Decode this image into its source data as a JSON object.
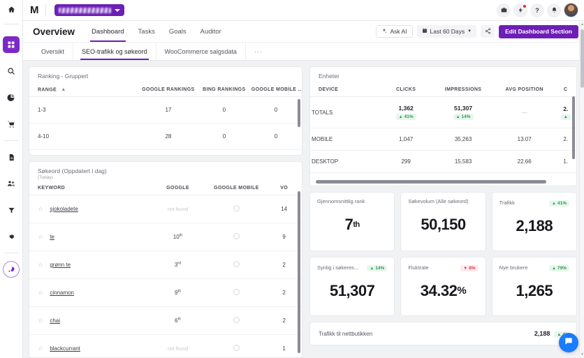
{
  "rail": {
    "home_icon": "home-icon",
    "items": [
      {
        "name": "dashboard",
        "icon": "grid-icon",
        "active": true
      },
      {
        "name": "search",
        "icon": "search-icon",
        "active": false
      },
      {
        "name": "analytics",
        "icon": "pie-chart-icon",
        "active": false
      },
      {
        "name": "ecommerce",
        "icon": "cart-icon",
        "active": false
      },
      {
        "name": "reports",
        "icon": "document-icon",
        "active": false
      },
      {
        "name": "audience",
        "icon": "people-icon",
        "active": false
      },
      {
        "name": "funnel",
        "icon": "funnel-icon",
        "active": false
      },
      {
        "name": "settings",
        "icon": "gear-icon",
        "active": false
      },
      {
        "name": "launch",
        "icon": "rocket-icon",
        "active": false
      }
    ]
  },
  "topbar": {
    "logo": "M",
    "account_name": "",
    "icons": [
      {
        "name": "briefcase-icon"
      },
      {
        "name": "bolt-icon"
      },
      {
        "name": "help-icon"
      },
      {
        "name": "bell-icon"
      }
    ],
    "avatar": "avatar"
  },
  "header": {
    "title": "Overview",
    "tabs": [
      {
        "label": "Dashboard",
        "active": true
      },
      {
        "label": "Tasks",
        "active": false
      },
      {
        "label": "Goals",
        "active": false
      },
      {
        "label": "Auditor",
        "active": false
      }
    ],
    "actions": {
      "ask_ai": "Ask AI",
      "date_range": "Last 60 Days",
      "share_icon": "share-icon",
      "edit": "Edit Dashboard Section"
    }
  },
  "subtabs": [
    {
      "label": "Oversikt",
      "active": false
    },
    {
      "label": "SEO-trafikk og søkeord",
      "active": true
    },
    {
      "label": "WooCommerce salgsdata",
      "active": false
    },
    {
      "label": "···",
      "active": false
    }
  ],
  "ranking_card": {
    "title": "Ranking - Gruppert",
    "columns": [
      "RANGE",
      "GOOGLE RANKINGS",
      "BING RANKINGS",
      "GOOGLE MOBILE ..."
    ],
    "rows": [
      {
        "range": "1-3",
        "google": "17",
        "bing": "0",
        "google_mobile": "0"
      },
      {
        "range": "4-10",
        "google": "28",
        "bing": "0",
        "google_mobile": "0"
      }
    ]
  },
  "keyword_card": {
    "title": "Søkeord (Oppdatert i dag)",
    "subtitle": "(Today)",
    "columns": [
      "KEYWORD",
      "GOOGLE",
      "GOOGLE MOBILE",
      "VO"
    ],
    "rows": [
      {
        "keyword": "sjokoladete",
        "google": "not found",
        "google_found": false,
        "google_mobile": "circle-icon",
        "volume": "14"
      },
      {
        "keyword": "te",
        "google": "10",
        "google_suffix": "th",
        "google_found": true,
        "google_mobile": "circle-icon",
        "volume": "9"
      },
      {
        "keyword": "grønn te",
        "google": "3",
        "google_suffix": "rd",
        "google_found": true,
        "google_mobile": "circle-icon",
        "volume": "2"
      },
      {
        "keyword": "cinnamon",
        "google": "9",
        "google_suffix": "th",
        "google_found": true,
        "google_mobile": "circle-icon",
        "volume": "2"
      },
      {
        "keyword": "chai",
        "google": "6",
        "google_suffix": "th",
        "google_found": true,
        "google_mobile": "circle-icon",
        "volume": "2"
      },
      {
        "keyword": "blackcurrant",
        "google": "not found",
        "google_found": false,
        "google_mobile": "circle-icon",
        "volume": "1"
      }
    ]
  },
  "devices_card": {
    "title": "Enheter",
    "columns": [
      "DEVICE",
      "CLICKS",
      "IMPRESSIONS",
      "AVG POSITION",
      "C"
    ],
    "rows": [
      {
        "device": "TOTALS",
        "clicks": "1,362",
        "clicks_delta": "41%",
        "clicks_dir": "up",
        "impressions": "51,307",
        "impressions_delta": "14%",
        "impressions_dir": "up",
        "avg_position": "—",
        "last": "2.",
        "last_delta": "",
        "last_dir": "up",
        "is_total": true
      },
      {
        "device": "MOBILE",
        "clicks": "1,047",
        "impressions": "35,263",
        "avg_position": "13.07",
        "last": "2.",
        "is_total": false
      },
      {
        "device": "DESKTOP",
        "clicks": "299",
        "impressions": "15,583",
        "avg_position": "22.66",
        "last": "1.",
        "is_total": false
      }
    ]
  },
  "kpis": [
    {
      "label": "Gjennomsnittlig rank",
      "value": "7",
      "suffix": "th",
      "badge": null
    },
    {
      "label": "Søkevolum (Alle søkeord)",
      "value": "50,150",
      "suffix": "",
      "badge": null
    },
    {
      "label": "Trafikk",
      "value": "2,188",
      "suffix": "",
      "badge": {
        "text": "41%",
        "dir": "up"
      }
    },
    {
      "label": "Synlig i søkeres...",
      "value": "51,307",
      "suffix": "",
      "badge": {
        "text": "14%",
        "dir": "up"
      }
    },
    {
      "label": "Fluktrate",
      "value": "34.32",
      "suffix": "%",
      "badge": {
        "text": "8%",
        "dir": "down"
      }
    },
    {
      "label": "Nye brukere",
      "value": "1,265",
      "suffix": "",
      "badge": {
        "text": "79%",
        "dir": "up"
      }
    }
  ],
  "bottom_strip": {
    "label": "Trafikk til nettbutikken",
    "value": "2,188",
    "badge": "4"
  },
  "chat": {
    "icon": "chat-icon"
  },
  "colors": {
    "brand_purple": "#6d1fb5",
    "accent_purple": "#7c29c9",
    "positive": "#2a9d54",
    "negative": "#d93a4a",
    "chat_blue": "#1a7cff"
  }
}
